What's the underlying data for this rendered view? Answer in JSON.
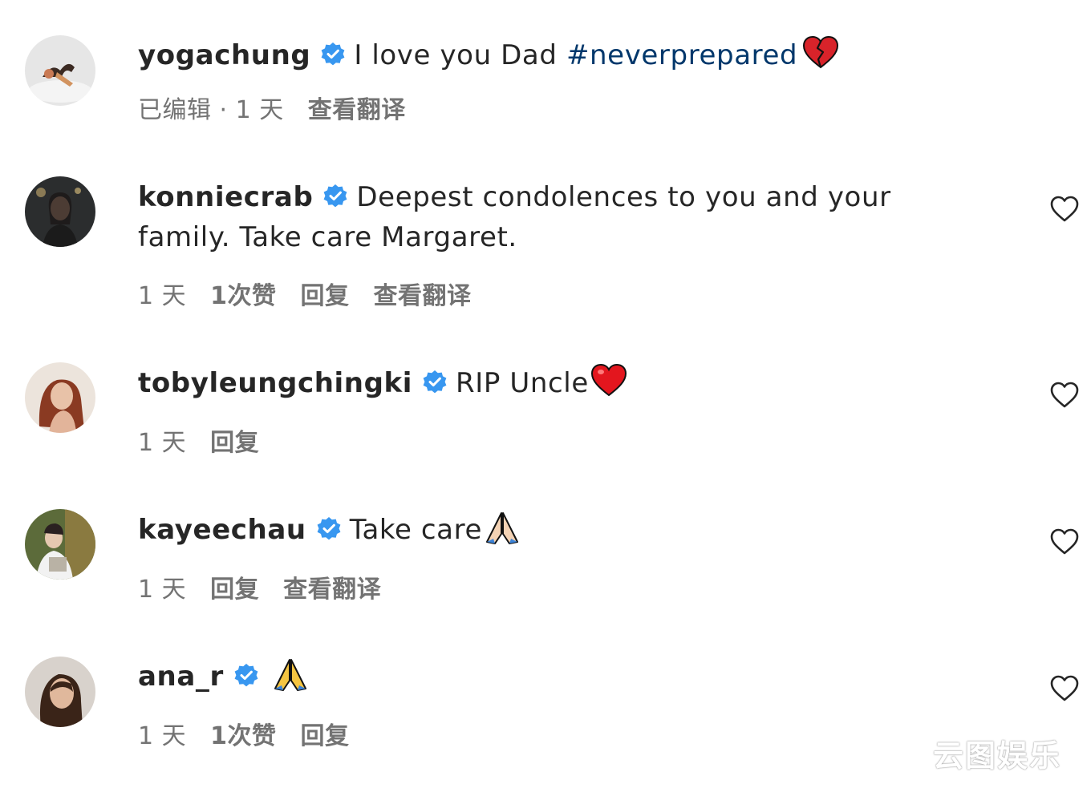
{
  "comments": [
    {
      "username": "yogachung",
      "text": "I love you Dad ",
      "hashtag": "#neverprepared",
      "emoji": "broken-heart-emoji",
      "meta": {
        "edited": "已编辑 · 1 天",
        "translate": "查看翻译"
      },
      "has_like": false
    },
    {
      "username": "konniecrab",
      "text": "Deepest condolences to you and your family. Take care Margaret.",
      "meta": {
        "time": "1 天",
        "likes": "1次赞",
        "reply": "回复",
        "translate": "查看翻译"
      },
      "has_like": true
    },
    {
      "username": "tobyleungchingki",
      "text": "RIP Uncle",
      "emoji": "red-heart-emoji",
      "meta": {
        "time": "1 天",
        "reply": "回复"
      },
      "has_like": true
    },
    {
      "username": "kayeechau",
      "text": "Take care",
      "emoji": "folded-hands-emoji",
      "meta": {
        "time": "1 天",
        "reply": "回复",
        "translate": "查看翻译"
      },
      "has_like": true
    },
    {
      "username": "ana_r",
      "text": "",
      "emoji": "folded-hands-emoji",
      "meta": {
        "time": "1 天",
        "likes": "1次赞",
        "reply": "回复"
      },
      "has_like": true
    }
  ],
  "watermark": "云图娱乐",
  "colors": {
    "verified": "#3897f0",
    "hashtag": "#00376b",
    "meta": "#737373",
    "text": "#262626"
  }
}
